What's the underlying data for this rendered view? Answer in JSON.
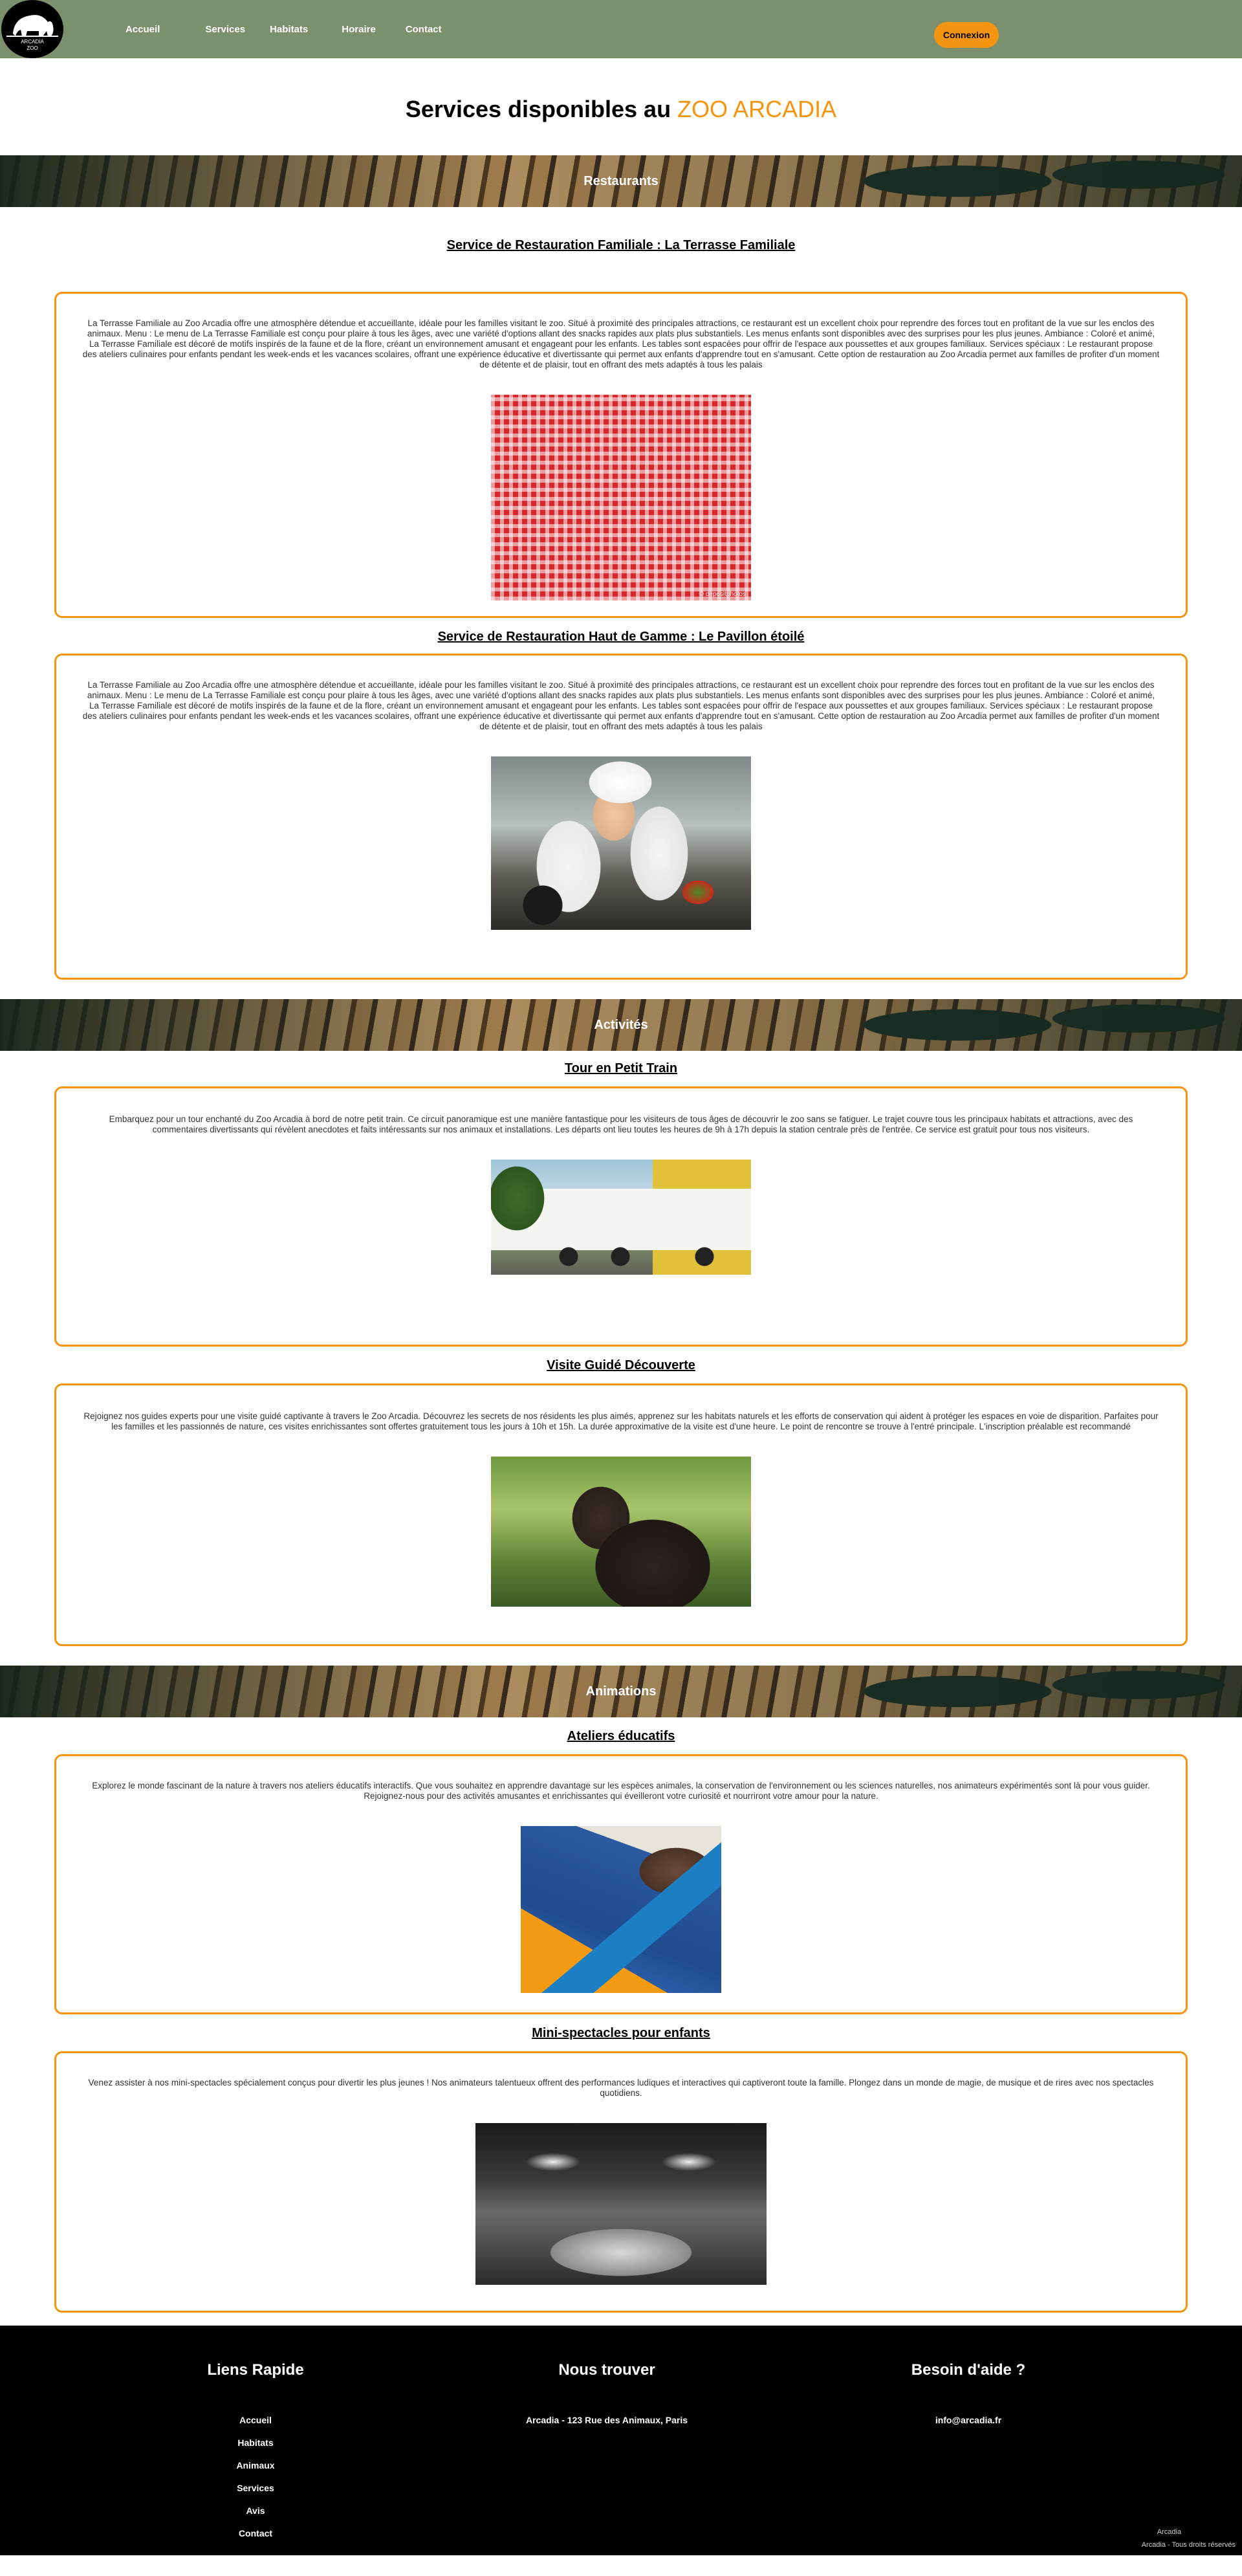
{
  "header": {
    "logo_text": "ARCADIA\nZOO",
    "nav": [
      "Accueil",
      "Services",
      "Habitats",
      "Horaire",
      "Contact"
    ],
    "login_label": "Connexion"
  },
  "page": {
    "title_prefix": "Services disponibles au",
    "title_brand": "ZOO ARCADIA"
  },
  "restaurants": {
    "banner": "Restaurants",
    "items": [
      {
        "title": "Service de Restauration Familiale : La Terrasse Familiale",
        "text": "La Terrasse Familiale au Zoo Arcadia offre une atmosphère détendue et accueillante, idéale pour les familles visitant le zoo. Situé à proximité des principales attractions, ce restaurant est un excellent choix pour reprendre des forces tout en profitant de la vue sur les enclos des animaux. Menu : Le menu de La Terrasse Familiale est conçu pour plaire à tous les âges, avec une variété d'options allant des snacks rapides aux plats plus substantiels. Les menus enfants sont disponibles avec des surprises pour les plus jeunes. Ambiance : Coloré et animé, La Terrasse Familiale est décoré de motifs inspirés de la faune et de la flore, créant un environnement amusant et engageant pour les enfants. Les tables sont espacées pour offrir de l'espace aux poussettes et aux groupes familiaux. Services spéciaux : Le restaurant propose des ateliers culinaires pour enfants pendant les week-ends et les vacances scolaires, offrant une expérience éducative et divertissante qui permet aux enfants d'apprendre tout en s'amusant. Cette option de restauration au Zoo Arcadia permet aux familles de profiter d'un moment de détente et de plaisir, tout en offrant des mets adaptés à tous les palais",
        "image": "red-checkered-tablecloth",
        "watermark": "© depositphotos"
      },
      {
        "title": "Service de Restauration Haut de Gamme : Le Pavillon étoilé",
        "text": "La Terrasse Familiale au Zoo Arcadia offre une atmosphère détendue et accueillante, idéale pour les familles visitant le zoo. Situé à proximité des principales attractions, ce restaurant est un excellent choix pour reprendre des forces tout en profitant de la vue sur les enclos des animaux. Menu : Le menu de La Terrasse Familiale est conçu pour plaire à tous les âges, avec une variété d'options allant des snacks rapides aux plats plus substantiels. Les menus enfants sont disponibles avec des surprises pour les plus jeunes. Ambiance : Coloré et animé, La Terrasse Familiale est décoré de motifs inspirés de la faune et de la flore, créant un environnement amusant et engageant pour les enfants. Les tables sont espacées pour offrir de l'espace aux poussettes et aux groupes familiaux. Services spéciaux : Le restaurant propose des ateliers culinaires pour enfants pendant les week-ends et les vacances scolaires, offrant une expérience éducative et divertissante qui permet aux enfants d'apprendre tout en s'amusant. Cette option de restauration au Zoo Arcadia permet aux familles de profiter d'un moment de détente et de plaisir, tout en offrant des mets adaptés à tous les palais",
        "image": "chefs-cooking"
      }
    ]
  },
  "activites": {
    "banner": "Activités",
    "items": [
      {
        "title": "Tour en Petit Train",
        "text": "Embarquez pour un tour enchanté du Zoo Arcadia à bord de notre petit train. Ce circuit panoramique est une manière fantastique pour les visiteurs de tous âges de découvrir le zoo sans se fatiguer. Le trajet couvre tous les principaux habitats et attractions, avec des commentaires divertissants qui révèlent anecdotes et faits intéressants sur nos animaux et installations. Les départs ont lieu toutes les heures de 9h à 17h depuis la station centrale près de l'entrée. Ce service est gratuit pour tous nos visiteurs.",
        "image": "petit-train"
      },
      {
        "title": "Visite Guidé Découverte",
        "text": "Rejoignez nos guides experts pour une visite guidé captivante à travers le Zoo Arcadia. Découvrez les secrets de nos résidents les plus aimés, apprenez sur les habitats naturels et les efforts de conservation qui aident à protéger les espaces en voie de disparition. Parfaites pour les familles et les passionnés de nature, ces visites enrichissantes sont offertes gratuitement tous les jours à 10h et 15h. La durée approximative de la visite est d'une heure. Le point de rencontre se trouve à l'entré principale. L'inscription préalable est recommandé",
        "image": "chimpanzee"
      }
    ]
  },
  "animations": {
    "banner": "Animations",
    "items": [
      {
        "title": "Ateliers éducatifs",
        "text": "Explorez le monde fascinant de la nature à travers nos ateliers éducatifs interactifs. Que vous souhaitez en apprendre davantage sur les espèces animales, la conservation de l'environnement ou les sciences naturelles, nos animateurs expérimentés sont là pour vous guider. Rejoignez-nous pour des activités amusantes et enrichissantes qui éveilleront votre curiosité et nourriront votre amour pour la nature.",
        "image": "paper-craft-animals"
      },
      {
        "title": "Mini-spectacles pour enfants",
        "text": "Venez assister à nos mini-spectacles spécialement conçus pour divertir les plus jeunes ! Nos animateurs talentueux offrent des performances ludiques et interactives qui captiveront toute la famille. Plongez dans un monde de magie, de musique et de rires avec nos spectacles quotidiens.",
        "image": "show-stage"
      }
    ]
  },
  "footer": {
    "col1_title": "Liens Rapide",
    "links": [
      "Accueil",
      "Habitats",
      "Animaux",
      "Services",
      "Avis",
      "Contact"
    ],
    "col2_title": "Nous trouver",
    "address": "Arcadia - 123 Rue des Animaux, Paris",
    "col3_title": "Besoin d'aide ?",
    "email": "info@arcadia.fr",
    "copy1": "Arcadia",
    "copy2": "Arcadia - Tous droits réservés"
  },
  "colors": {
    "accent": "#f5940e",
    "header_bg": "#7d906e",
    "footer_bg": "#000000"
  }
}
